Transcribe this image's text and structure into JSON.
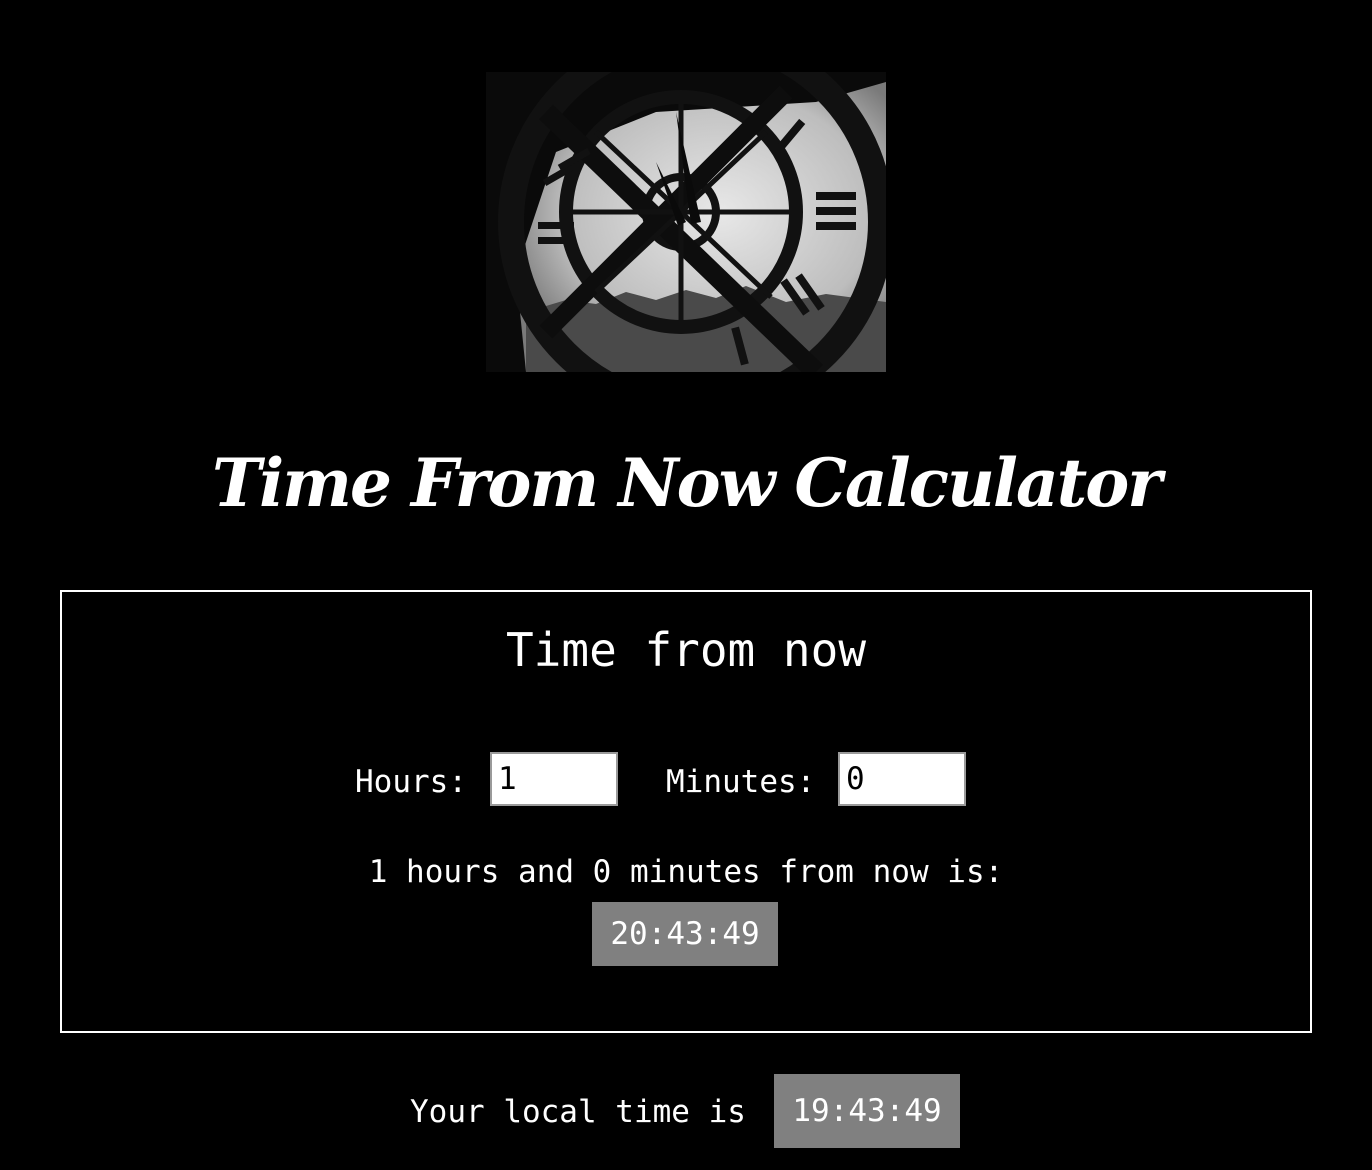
{
  "header": {
    "image_icon": "clock-face-photo",
    "title": "Time From Now Calculator"
  },
  "calculator": {
    "heading": "Time from now",
    "hours_label": "Hours:",
    "hours_value": "1",
    "minutes_label": "Minutes:",
    "minutes_value": "0",
    "result_text": "1 hours and 0 minutes from now is:",
    "result_time": "20:43:49"
  },
  "local": {
    "label": "Your local time is",
    "time": "19:43:49"
  },
  "colors": {
    "background": "#000000",
    "text": "#ffffff",
    "badge": "#808080"
  }
}
